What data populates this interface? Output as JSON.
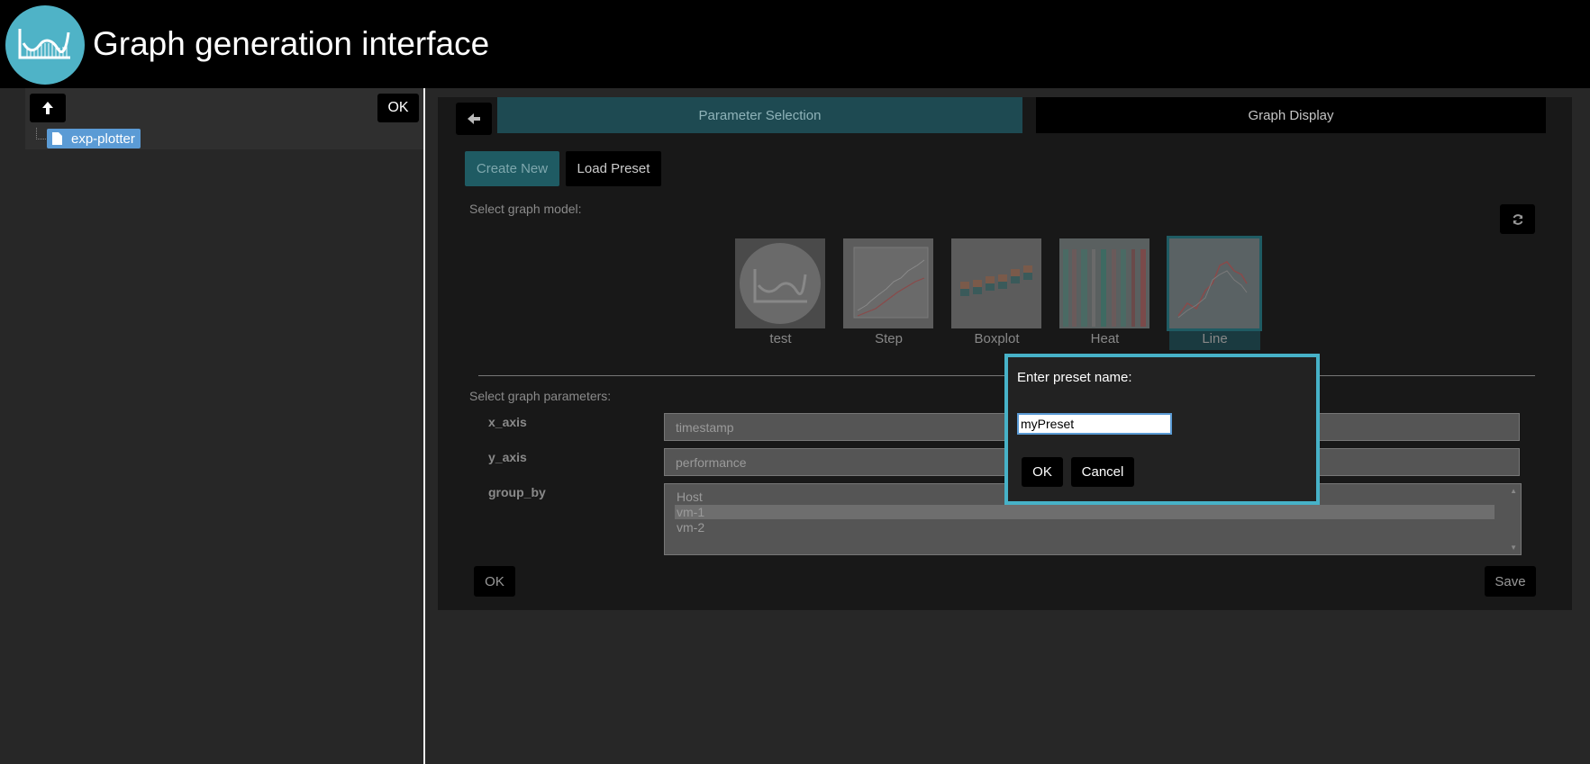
{
  "header": {
    "title": "Graph generation interface",
    "logo_icon": "wave-chart-logo-icon"
  },
  "sidebar": {
    "up_icon": "arrow-up-icon",
    "ok_label": "OK",
    "tree": [
      {
        "label": "exp-plotter",
        "icon": "file-icon"
      }
    ]
  },
  "main": {
    "back_icon": "arrow-left-icon",
    "tabs": [
      {
        "label": "Parameter Selection",
        "active": true
      },
      {
        "label": "Graph Display",
        "active": false
      }
    ],
    "mode_buttons": {
      "create_new": "Create New",
      "load_preset": "Load Preset"
    },
    "select_model_label": "Select graph model:",
    "refresh_icon": "refresh-icon",
    "models": [
      {
        "name": "test",
        "selected": false
      },
      {
        "name": "Step",
        "selected": false
      },
      {
        "name": "Boxplot",
        "selected": false
      },
      {
        "name": "Heat",
        "selected": false
      },
      {
        "name": "Line",
        "selected": true
      }
    ],
    "select_params_label": "Select graph parameters:",
    "params": {
      "x_axis": {
        "label": "x_axis",
        "value": "timestamp"
      },
      "y_axis": {
        "label": "y_axis",
        "value": "performance"
      },
      "group_by": {
        "label": "group_by",
        "options": [
          "Host",
          "vm-1",
          "vm-2"
        ],
        "selected": "vm-1"
      }
    },
    "ok_label": "OK",
    "save_label": "Save"
  },
  "dialog": {
    "title": "Enter preset name:",
    "input_value": "myPreset",
    "ok_label": "OK",
    "cancel_label": "Cancel"
  },
  "colors": {
    "accent": "#47b2c8",
    "tab_active": "#1e4a52",
    "selection": "#5b9bd5"
  }
}
